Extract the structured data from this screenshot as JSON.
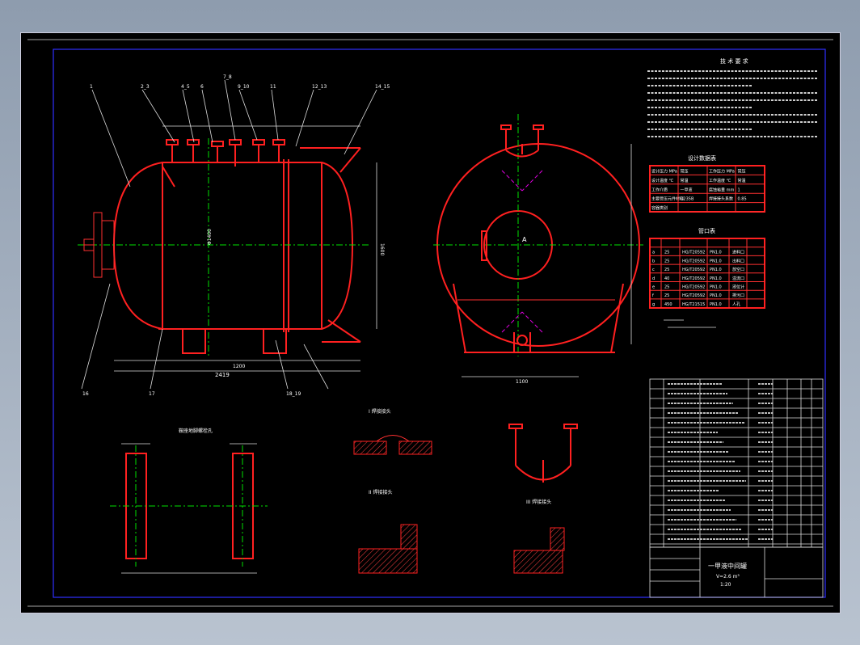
{
  "title_block": {
    "drawing_title": "一甲液中间罐",
    "sub": "V=2.6 m³",
    "scale": "1:20"
  },
  "notes": {
    "heading": "技 术 要 求"
  },
  "tables": {
    "design_data_heading": "设计数据表",
    "nozzle_heading": "管口表",
    "design_rows": [
      [
        "设计压力 MPa",
        "常压",
        "工作压力 MPa",
        "常压"
      ],
      [
        "设计温度 ℃",
        "常温",
        "工作温度 ℃",
        "常温"
      ],
      [
        "工作介质",
        "一甲液",
        "腐蚀裕量 mm",
        "1"
      ],
      [
        "主要受压元件材料",
        "Q235B",
        "焊接接头系数",
        "0.85"
      ],
      [
        "容器类别",
        "",
        "",
        ""
      ]
    ],
    "nozzle_rows": [
      [
        "a",
        "25",
        "HG/T20592",
        "PN1.0",
        "进料口"
      ],
      [
        "b",
        "25",
        "HG/T20592",
        "PN1.0",
        "出料口"
      ],
      [
        "c",
        "25",
        "HG/T20592",
        "PN1.0",
        "放空口"
      ],
      [
        "d",
        "40",
        "HG/T20592",
        "PN1.0",
        "溢流口"
      ],
      [
        "e",
        "25",
        "HG/T20592",
        "PN1.0",
        "液位计"
      ],
      [
        "f",
        "25",
        "HG/T20592",
        "PN1.0",
        "排污口"
      ],
      [
        "g",
        "450",
        "HG/T21515",
        "PN1.0",
        "人孔"
      ]
    ]
  },
  "dimensions": {
    "overall_length": "2419",
    "spacing": "1200",
    "height": "1600",
    "support_width": "1100",
    "dia": "Φ1400"
  },
  "views": {
    "front_callouts": [
      "1",
      "2_3",
      "4_5",
      "6",
      "7_8",
      "9_10",
      "11",
      "12_13",
      "14_15",
      "16",
      "17",
      "18_19"
    ],
    "side_label": "A",
    "detail_titles": [
      "鞍座地脚螺栓孔",
      "I 焊接接头",
      "II 焊接接头",
      "III 焊接接头"
    ]
  },
  "colors": {
    "background": "#000000",
    "vessel": "#ff2020",
    "centerline": "#00e000",
    "frame": "#3030ff"
  }
}
